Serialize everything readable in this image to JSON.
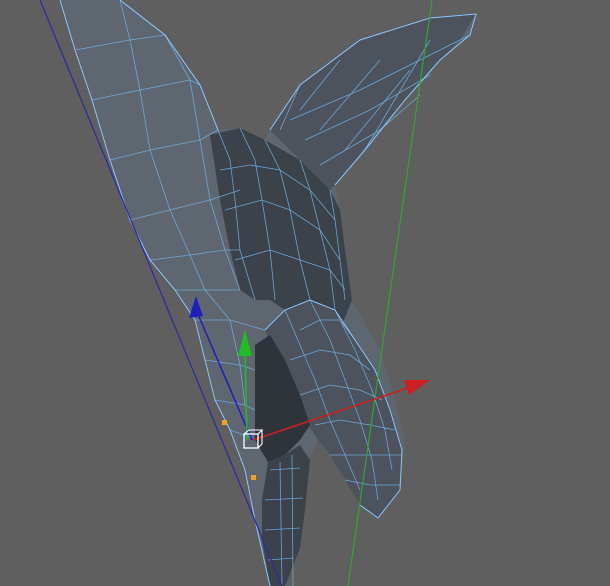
{
  "viewport": {
    "background_color": "#5f5f5f",
    "mesh": {
      "face_color": "#4c535c",
      "wire_color": "#6fb4e8"
    },
    "guides": {
      "left_line_color": "#2a2aa6",
      "vertical_line_color": "#2ea82e"
    },
    "gizmo": {
      "x_axis_color": "#cc1f1f",
      "y_axis_color": "#1fbf1f",
      "z_axis_color": "#1f1fbf",
      "pivot_icon": "cube-pivot-icon",
      "handle_color": "#f0a020"
    }
  }
}
